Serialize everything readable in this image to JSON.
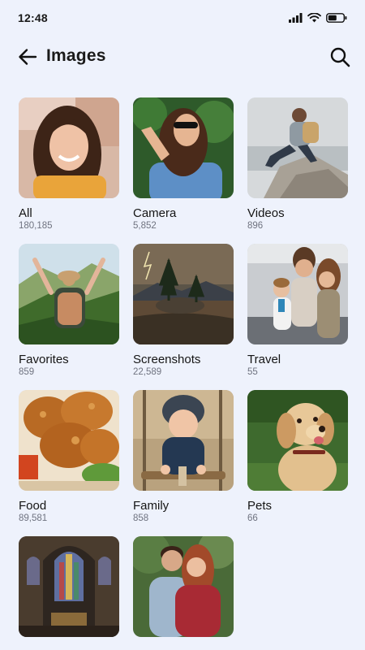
{
  "status_bar": {
    "time": "12:48"
  },
  "header": {
    "title": "Images"
  },
  "albums": [
    {
      "name": "All",
      "count": "180,185"
    },
    {
      "name": "Camera",
      "count": "5,852"
    },
    {
      "name": "Videos",
      "count": "896"
    },
    {
      "name": "Favorites",
      "count": "859"
    },
    {
      "name": "Screenshots",
      "count": "22,589"
    },
    {
      "name": "Travel",
      "count": "55"
    },
    {
      "name": "Food",
      "count": "89,581"
    },
    {
      "name": "Family",
      "count": "858"
    },
    {
      "name": "Pets",
      "count": "66"
    },
    {
      "name": "",
      "count": ""
    },
    {
      "name": "",
      "count": ""
    }
  ],
  "colors": {
    "background": "#eef2fc",
    "text": "#151515",
    "subtext": "#6f7380"
  }
}
